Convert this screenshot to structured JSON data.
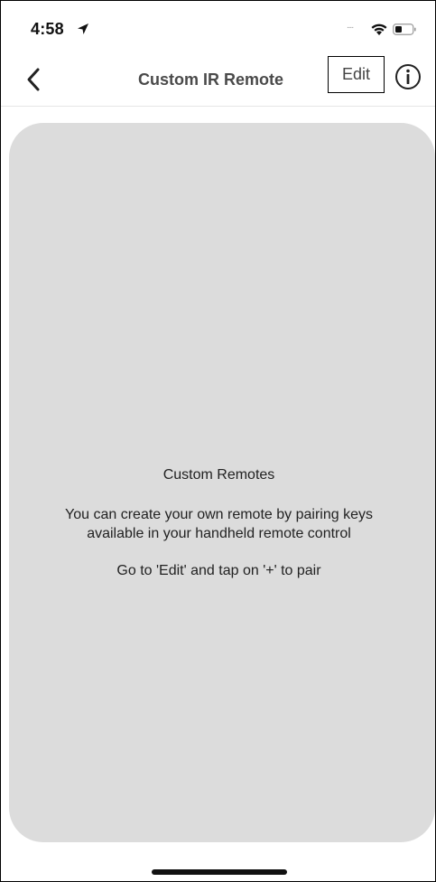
{
  "status_bar": {
    "time": "4:58",
    "signal_dots": "....",
    "icons": [
      "location-arrow-icon",
      "wifi-icon",
      "battery-icon"
    ]
  },
  "nav": {
    "back_icon": "chevron-left-icon",
    "title": "Custom IR Remote",
    "edit_label": "Edit",
    "info_icon": "info-circle-icon"
  },
  "empty_state": {
    "title": "Custom Remotes",
    "description_line1": "You can create your own remote by pairing keys",
    "description_line2": "available in your handheld remote control",
    "hint": "Go to 'Edit' and tap on '+' to pair"
  },
  "colors": {
    "card_background": "#dcdcdc",
    "title_text": "#4a4a4a",
    "body_text": "#222222"
  }
}
